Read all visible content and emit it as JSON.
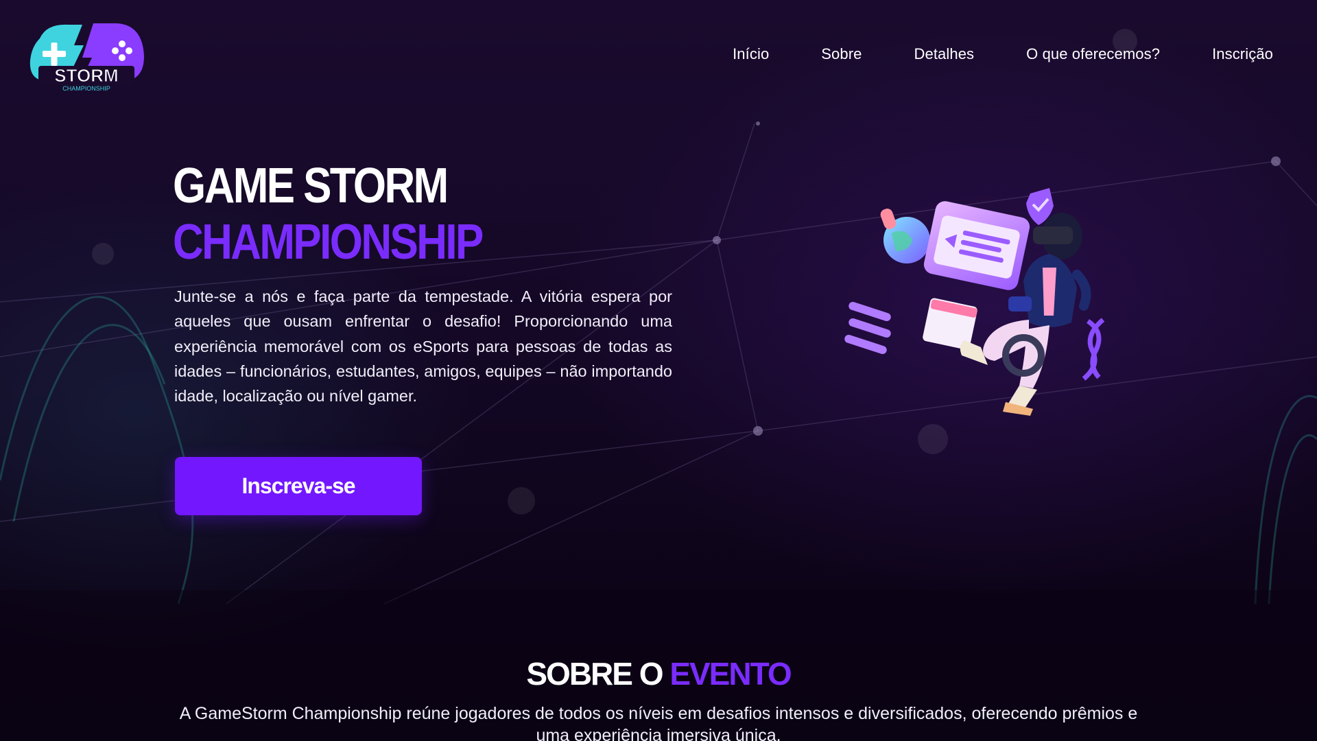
{
  "brand": {
    "logo_text": "STORM",
    "logo_subtext": "CHAMPIONSHIP"
  },
  "nav": {
    "items": [
      {
        "label": "Início"
      },
      {
        "label": "Sobre"
      },
      {
        "label": "Detalhes"
      },
      {
        "label": "O que oferecemos?"
      },
      {
        "label": "Inscrição"
      }
    ]
  },
  "hero": {
    "title_line1": "GAME STORM",
    "title_line2": "CHAMPIONSHIP",
    "description": "Junte-se a nós e faça parte da tempestade. A vitória espera por aqueles que ousam enfrentar o desafio! Proporcionando uma experiência memorável com os eSports para pessoas de todas as idades – funcionários, estudantes, amigos, equipes – não importando idade, localização ou nível gamer.",
    "cta_label": "Inscreva-se"
  },
  "about": {
    "title_word1": "SOBRE O",
    "title_word2": "EVENTO",
    "text": "A GameStorm Championship reúne jogadores de todos os níveis em desafios intensos e diversificados, oferecendo prêmios e uma experiência imersiva única."
  },
  "colors": {
    "accent": "#7317ff",
    "accent_text": "#7a2cff",
    "background": "#140826",
    "logo_cyan": "#3fd3e0",
    "logo_purple": "#8a3cff"
  }
}
